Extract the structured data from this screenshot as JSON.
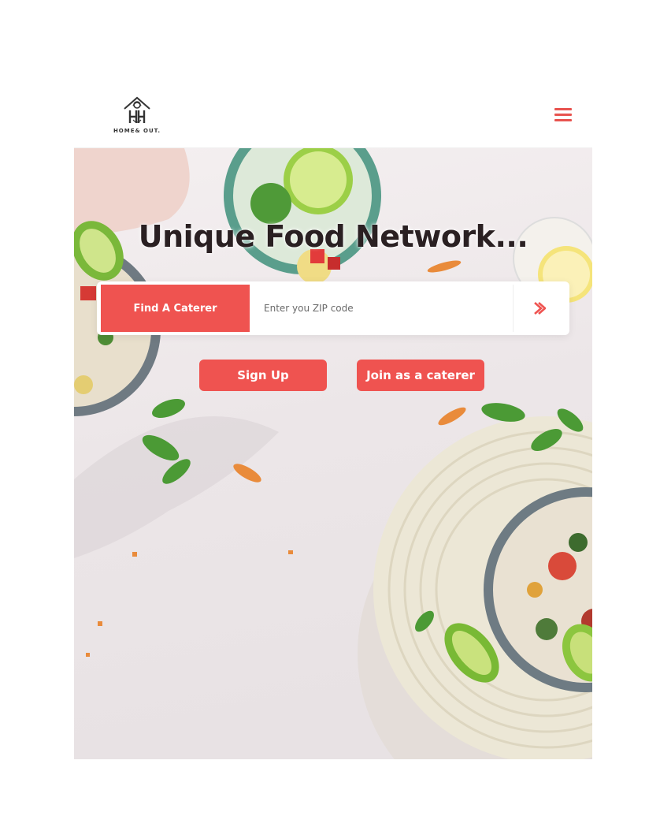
{
  "brand": {
    "logo_text": "HOME& OUT."
  },
  "header": {
    "menu_icon": "hamburger-menu-icon"
  },
  "hero": {
    "title": "Unique Food Network...",
    "search": {
      "find_label": "Find A Caterer",
      "zip_placeholder": "Enter you ZIP code",
      "zip_value": "",
      "go_icon": "chevron-right-icon"
    },
    "actions": {
      "signup_label": "Sign Up",
      "join_label": "Join as a caterer"
    }
  },
  "colors": {
    "accent": "#ef5350",
    "title_text": "#2a2022",
    "background": "#ffffff"
  }
}
